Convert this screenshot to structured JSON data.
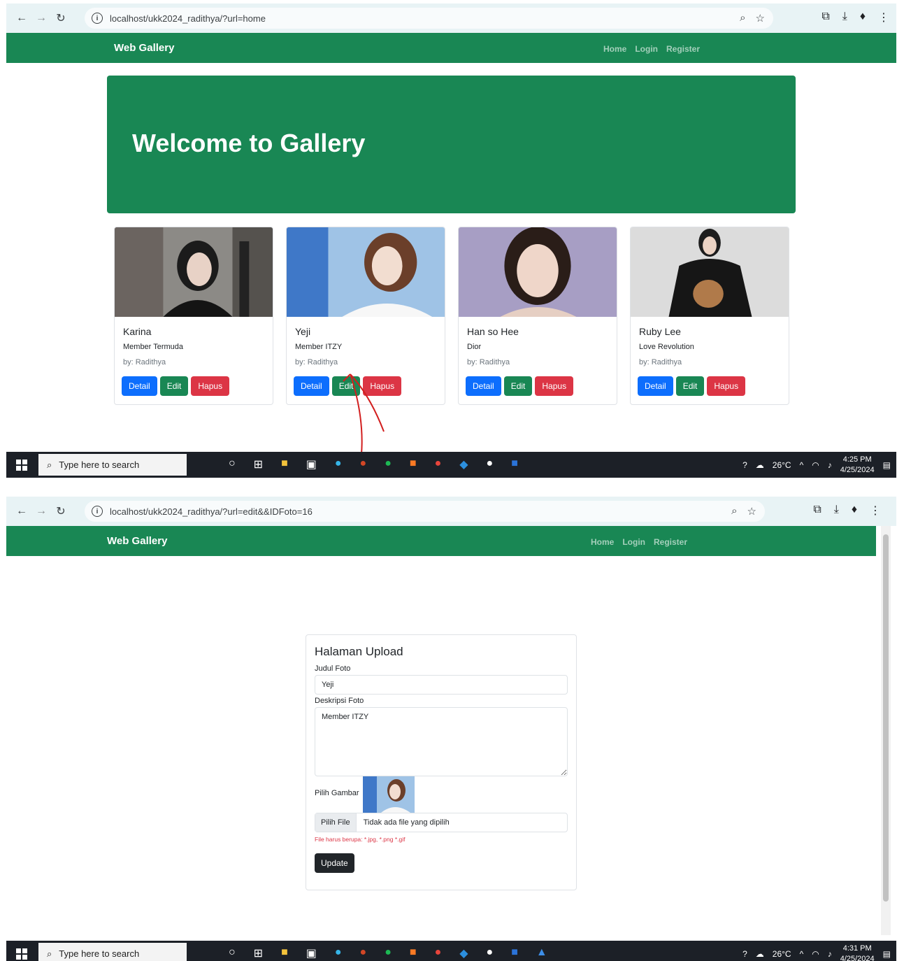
{
  "shot1": {
    "url": "localhost/ukk2024_radithya/?url=home",
    "brand": "Web Gallery",
    "nav": [
      "Home",
      "Login",
      "Register"
    ],
    "jumbotron_title": "Welcome to Gallery",
    "cards": [
      {
        "title": "Karina",
        "desc": "Member Termuda",
        "by": "by: Radithya"
      },
      {
        "title": "Yeji",
        "desc": "Member ITZY",
        "by": "by: Radithya"
      },
      {
        "title": "Han so Hee",
        "desc": "Dior",
        "by": "by: Radithya"
      },
      {
        "title": "Ruby Lee",
        "desc": "Love Revolution",
        "by": "by: Radithya"
      }
    ],
    "buttons": {
      "detail": "Detail",
      "edit": "Edit",
      "hapus": "Hapus"
    },
    "taskbar": {
      "search": "Type here to search",
      "temp": "26°C",
      "time": "4:25 PM",
      "date": "4/25/2024"
    }
  },
  "shot2": {
    "url": "localhost/ukk2024_radithya/?url=edit&&IDFoto=16",
    "brand": "Web Gallery",
    "nav": [
      "Home",
      "Login",
      "Register"
    ],
    "form": {
      "title": "Halaman Upload",
      "judul_label": "Judul Foto",
      "judul_value": "Yeji",
      "desk_label": "Deskripsi Foto",
      "desk_value": "Member ITZY",
      "gambar_label": "Pilih Gambar",
      "file_button": "Pilih File",
      "file_text": "Tidak ada file yang dipilih",
      "hint": "File harus berupa: *.jpg, *.png *.gif",
      "submit": "Update"
    },
    "taskbar": {
      "search": "Type here to search",
      "temp": "26°C",
      "time": "4:31 PM",
      "date": "4/25/2024"
    }
  },
  "colors": {
    "navbar": "#198754",
    "primary": "#0d6efd",
    "success": "#198754",
    "danger": "#dc3545",
    "dark": "#212529"
  }
}
